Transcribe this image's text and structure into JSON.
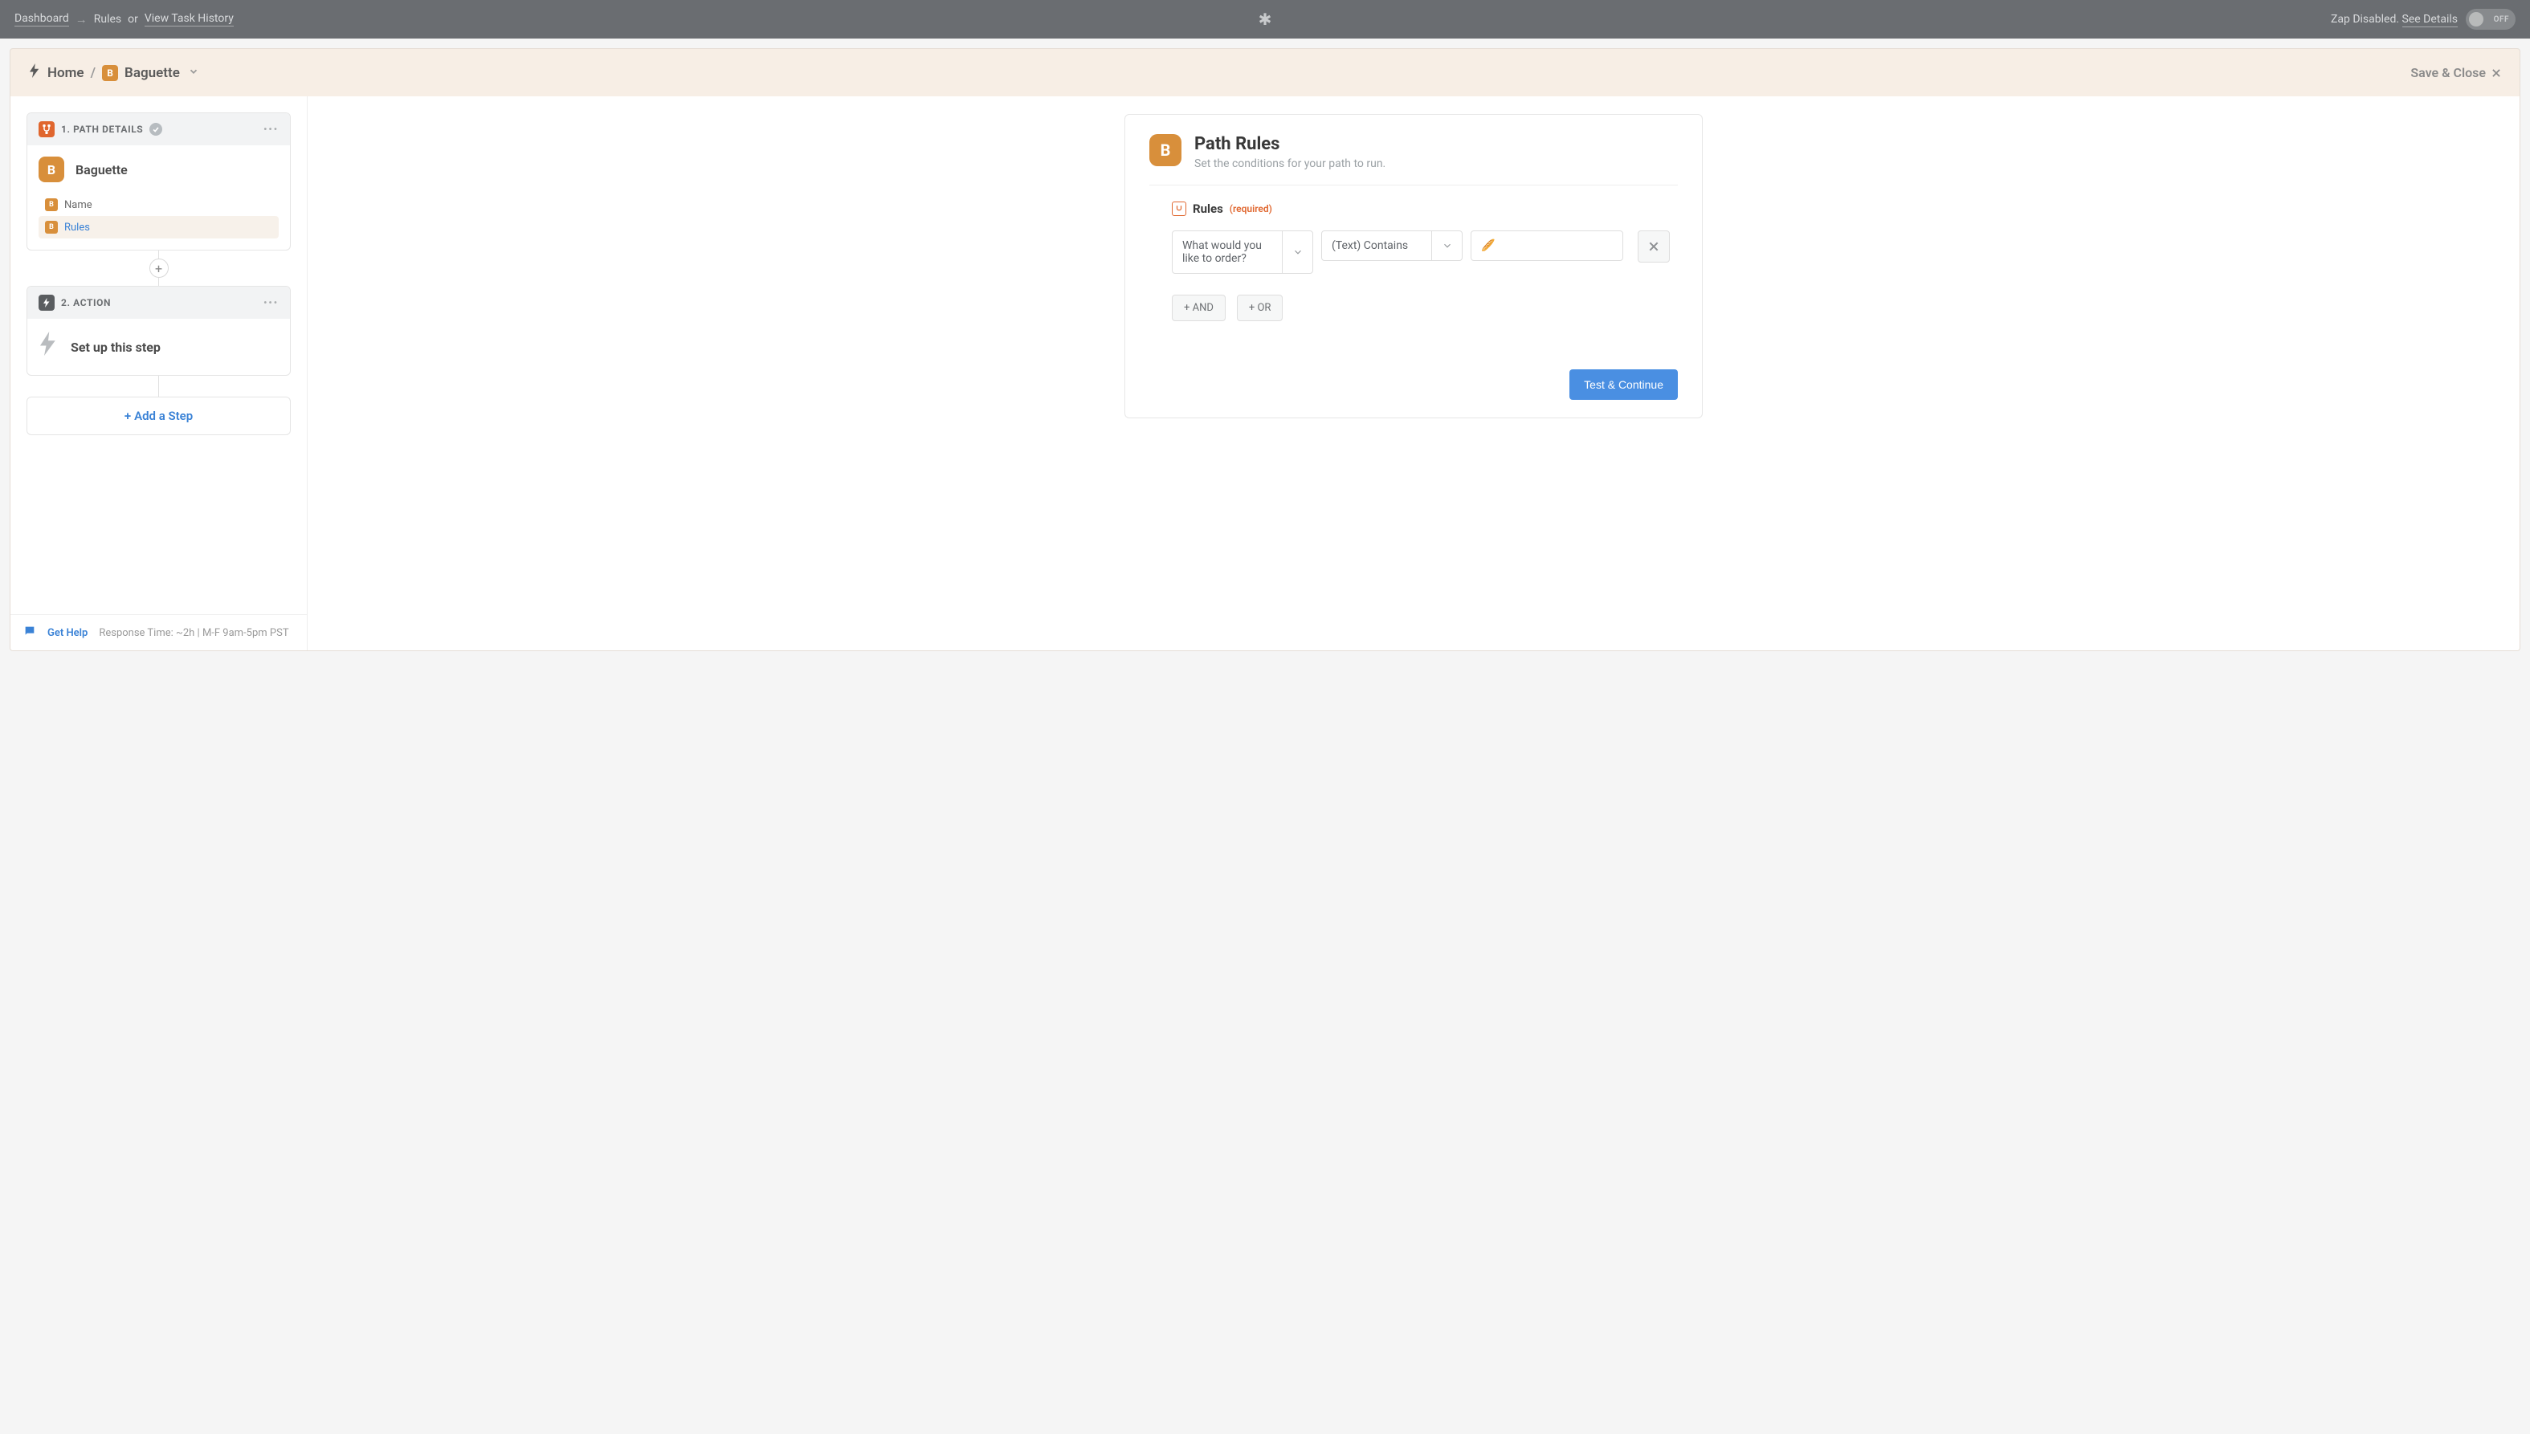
{
  "topbar": {
    "dashboard": "Dashboard",
    "rules": "Rules",
    "or": "or",
    "history": "View Task History",
    "status": "Zap Disabled.",
    "see_details": "See Details",
    "toggle": "OFF"
  },
  "header": {
    "home": "Home",
    "sep": "/",
    "badge": "B",
    "name": "Baguette",
    "save_close": "Save & Close"
  },
  "sidebar": {
    "step1": {
      "title": "1. PATH DETAILS",
      "badge": "B",
      "name": "Baguette",
      "rows": {
        "name": {
          "badge": "B",
          "label": "Name"
        },
        "rules": {
          "badge": "B",
          "label": "Rules"
        }
      }
    },
    "step2": {
      "title": "2. ACTION",
      "setup": "Set up this step"
    },
    "add_step": "Add a Step",
    "help": {
      "label": "Get Help",
      "meta": "Response Time: ~2h | M-F 9am-5pm PST"
    }
  },
  "panel": {
    "badge": "B",
    "title": "Path Rules",
    "sub": "Set the conditions for your path to run.",
    "rules_label": "Rules",
    "required": "(required)",
    "rule": {
      "field": "What would you like to order?",
      "cond": "(Text) Contains",
      "value": "🥖"
    },
    "and_btn": "+ AND",
    "or_btn": "+ OR",
    "test_btn": "Test & Continue"
  }
}
